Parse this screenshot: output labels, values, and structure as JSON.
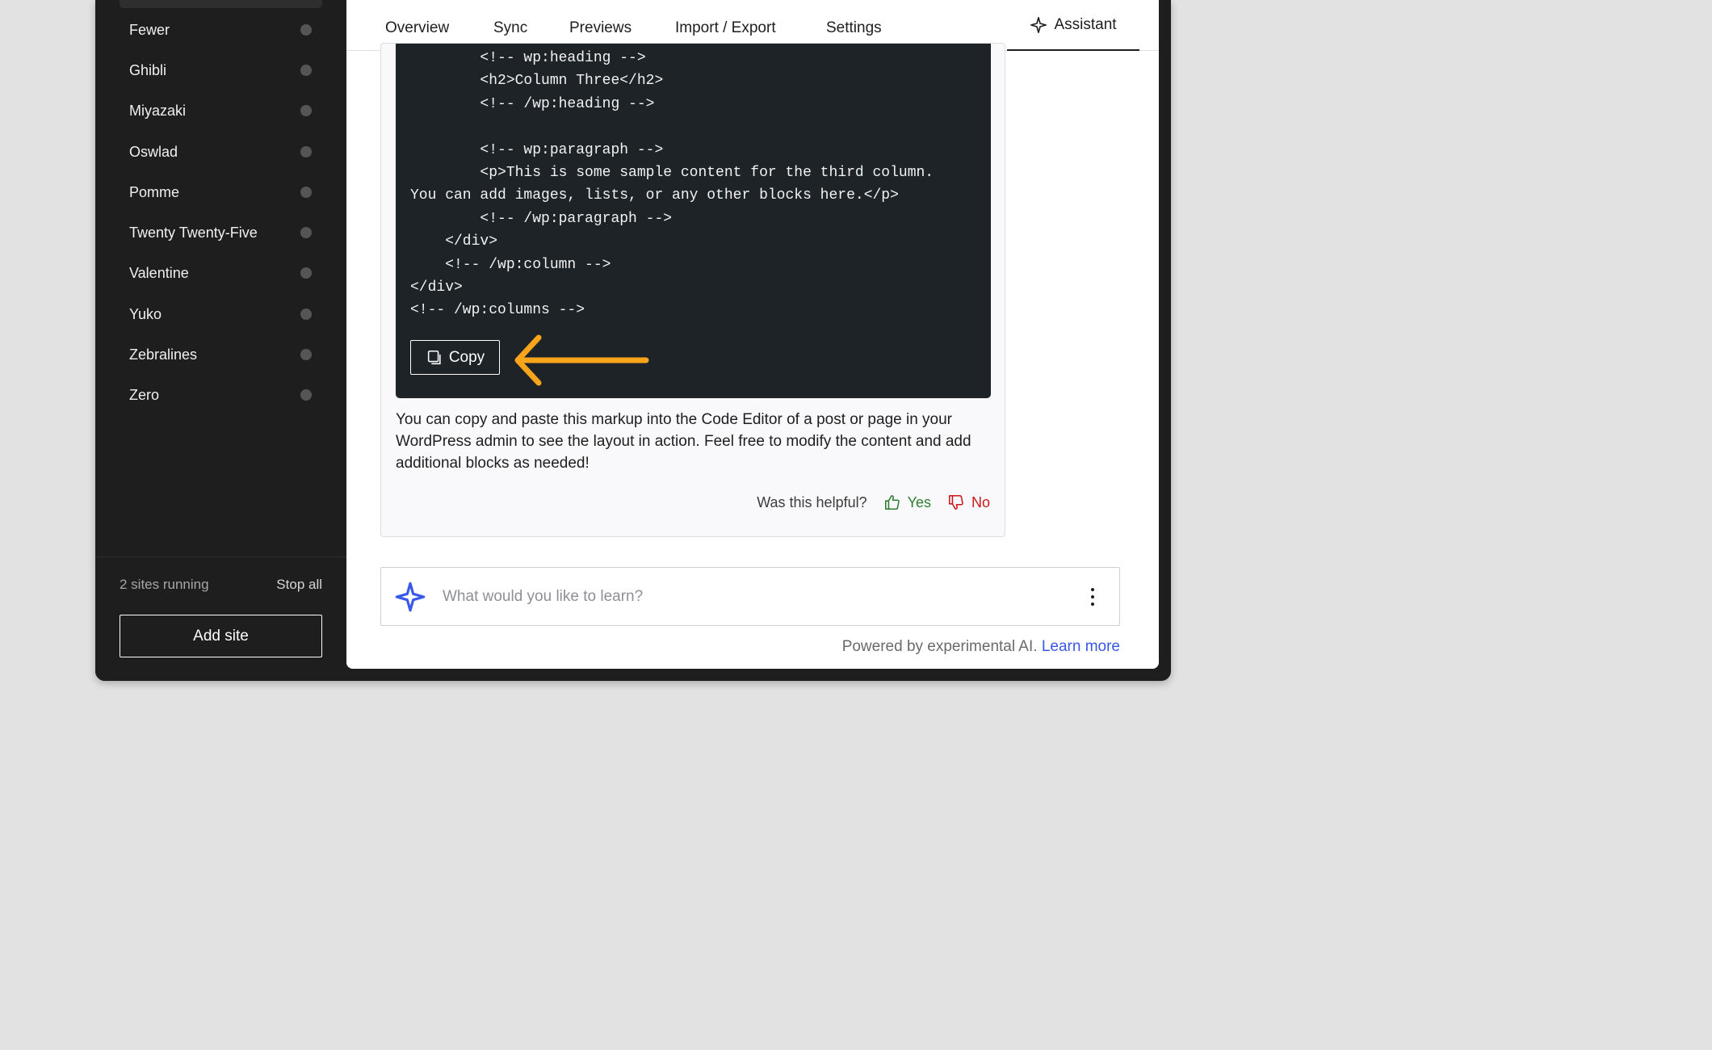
{
  "sidebar": {
    "sites": [
      {
        "name": "Fewer"
      },
      {
        "name": "Ghibli"
      },
      {
        "name": "Miyazaki"
      },
      {
        "name": "Oswlad"
      },
      {
        "name": "Pomme"
      },
      {
        "name": "Twenty Twenty-Five"
      },
      {
        "name": "Valentine"
      },
      {
        "name": "Yuko"
      },
      {
        "name": "Zebralines"
      },
      {
        "name": "Zero"
      }
    ],
    "running_status": "2 sites running",
    "stop_all_label": "Stop all",
    "add_site_label": "Add site"
  },
  "tabs": [
    {
      "label": "Overview"
    },
    {
      "label": "Sync"
    },
    {
      "label": "Previews"
    },
    {
      "label": "Import / Export"
    },
    {
      "label": "Settings"
    }
  ],
  "assistant_tab": {
    "label": "Assistant",
    "icon": "sparkle-icon",
    "active": true
  },
  "assistant_message": {
    "code_lines": [
      "        <!-- wp:heading -->",
      "        <h2>Column Three</h2>",
      "        <!-- /wp:heading -->",
      "",
      "        <!-- wp:paragraph -->",
      "        <p>This is some sample content for the third column.",
      "You can add images, lists, or any other blocks here.</p>",
      "        <!-- /wp:paragraph -->",
      "    </div>",
      "    <!-- /wp:column -->",
      "</div>",
      "<!-- /wp:columns -->"
    ],
    "copy_label": "Copy",
    "copy_icon": "copy-icon",
    "text": "You can copy and paste this markup into the Code Editor of a post or page in your WordPress admin to see the layout in action. Feel free to modify the content and add additional blocks as needed!",
    "feedback": {
      "question": "Was this helpful?",
      "yes_label": "Yes",
      "no_label": "No"
    }
  },
  "annotation": {
    "arrow_color": "#f9a51b",
    "icon": "arrow-left-icon"
  },
  "chat_input": {
    "placeholder": "What would you like to learn?",
    "icon": "sparkle-icon",
    "menu_icon": "vertical-ellipsis-icon"
  },
  "footer": {
    "text": "Powered by experimental AI.",
    "link_label": "Learn more"
  },
  "colors": {
    "sidebar_bg": "#1e1e1e",
    "code_bg": "#1d2327",
    "accent_blue": "#3858e9",
    "yes_green": "#2e7d32",
    "no_red": "#cc1818"
  }
}
